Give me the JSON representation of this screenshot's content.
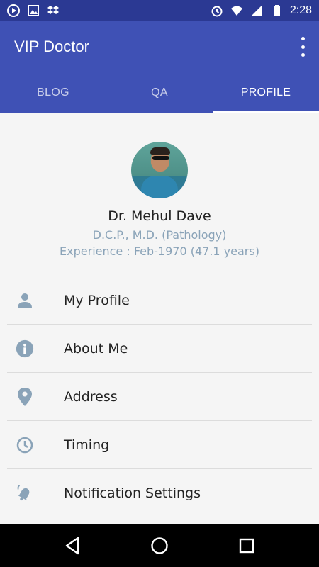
{
  "status_bar": {
    "time": "2:28",
    "left_icons": [
      "play-store-icon",
      "image-icon",
      "dropbox-icon"
    ],
    "right_icons": [
      "alarm-icon",
      "wifi-icon",
      "signal-icon",
      "battery-icon"
    ]
  },
  "app_bar": {
    "title": "VIP Doctor",
    "overflow_icon": "more-vert-icon"
  },
  "tabs": [
    {
      "label": "BLOG",
      "active": false
    },
    {
      "label": "QA",
      "active": false
    },
    {
      "label": "PROFILE",
      "active": true
    }
  ],
  "profile": {
    "name": "Dr. Mehul Dave",
    "qualification": "D.C.P., M.D. (Pathology)",
    "experience": "Experience : Feb-1970 (47.1 years)"
  },
  "menu": [
    {
      "label": "My Profile",
      "icon": "person-icon"
    },
    {
      "label": "About Me",
      "icon": "info-icon"
    },
    {
      "label": "Address",
      "icon": "location-pin-icon"
    },
    {
      "label": "Timing",
      "icon": "clock-icon"
    },
    {
      "label": "Notification Settings",
      "icon": "bell-icon"
    }
  ],
  "colors": {
    "primary": "#3f51b5",
    "status_bar": "#2b3993",
    "icon_gray_blue": "#8aa3b8",
    "background": "#f5f5f5"
  },
  "nav_bar": {
    "buttons": [
      "back-icon",
      "home-icon",
      "recents-icon"
    ]
  }
}
